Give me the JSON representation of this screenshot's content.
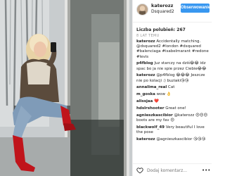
{
  "post": {
    "username": "katerozz",
    "location": "Dsquared2",
    "follow_label": "Obserwowanie",
    "likes": "Liczba polubień: 267",
    "time": "8 LAT TEMU"
  },
  "comments": [
    {
      "user": "katerozz",
      "text": "Accidentally matching. @dsquared2 #london #dsquared #balenciaga #isabelmarant #redone #levis"
    },
    {
      "user": "p4fblog",
      "text": "Juz starczy na dziś😂😂 idz spac bo ja nie spie przez Ciebie😂😂"
    },
    {
      "user": "katerozz",
      "text": "@p4fblog 😂😂😂 Jeszcze nie po kolacji :) buziaki😘😘"
    },
    {
      "user": "annalima_real",
      "text": "Cat"
    },
    {
      "user": "m_goska",
      "text": "wow 👌"
    },
    {
      "user": "alissjaa",
      "text": "❤️"
    },
    {
      "user": "hdslrshooter",
      "text": "Great one!"
    },
    {
      "user": "agnieszkascibior",
      "text": "@katerozz 😍😍😍 boots are my fav 😍"
    },
    {
      "user": "blackwolf_49",
      "text": "Very beautiful I love the pose"
    },
    {
      "user": "katerozz",
      "text": "@agnieszkascibior 😘😘😘"
    }
  ],
  "add_comment": {
    "placeholder": "Dodaj komentarz...",
    "heart_icon": "heart-icon",
    "more_icon": "more-icon"
  },
  "colors": {
    "follow_button": "#3897f0",
    "text": "#262626",
    "muted": "#999999"
  }
}
